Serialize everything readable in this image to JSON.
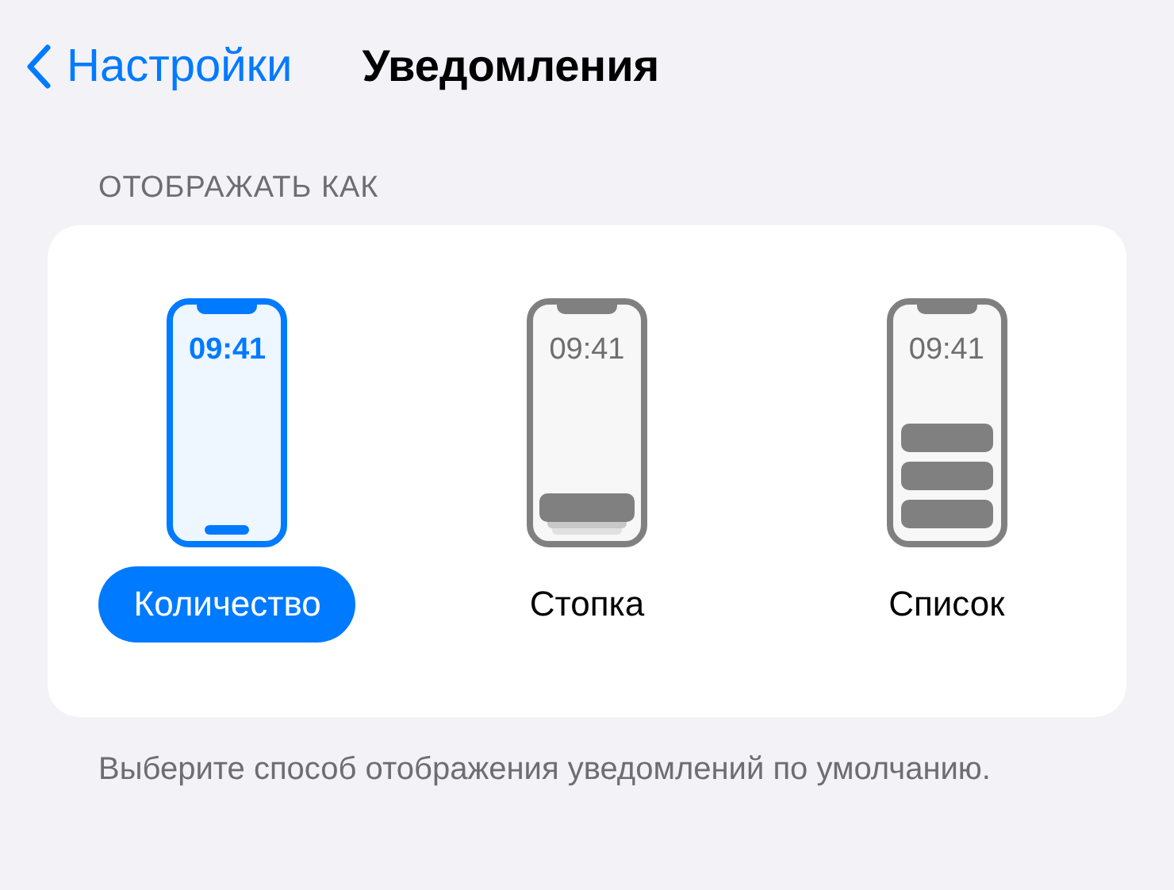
{
  "nav": {
    "back_label": "Настройки",
    "title": "Уведомления"
  },
  "section": {
    "header": "ОТОБРАЖАТЬ КАК",
    "options": [
      {
        "kind": "count",
        "label": "Количество",
        "time": "09:41",
        "selected": true
      },
      {
        "kind": "stack",
        "label": "Стопка",
        "time": "09:41",
        "selected": false
      },
      {
        "kind": "list",
        "label": "Список",
        "time": "09:41",
        "selected": false
      }
    ],
    "footer": "Выберите способ отображения уведомлений по умолчанию."
  }
}
